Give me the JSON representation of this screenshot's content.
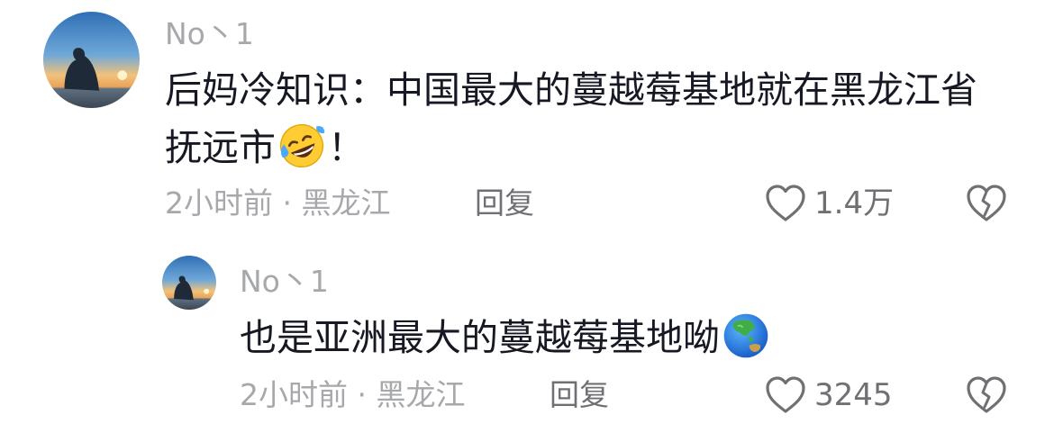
{
  "comments": [
    {
      "username": "No丶1",
      "text_before_emoji": "后妈冷知识：中国最大的蔓越莓基地就在黑龙江省抚远市",
      "emoji_icon": "rolling-on-floor-laughing-emoji",
      "text_after_emoji": "！",
      "meta": "2小时前 · 黑龙江",
      "reply_label": "回复",
      "likes": "1.4万",
      "replies": [
        {
          "username": "No丶1",
          "text_before_emoji": "也是亚洲最大的蔓越莓基地呦",
          "emoji_icon": "globe-asia-australia-emoji",
          "meta": "2小时前 · 黑龙江",
          "reply_label": "回复",
          "likes": "3245"
        }
      ]
    }
  ],
  "colors": {
    "text_primary": "#161823",
    "text_secondary": "#a7a8ac",
    "action_text": "#6f7074",
    "icon_stroke": "#6f7074"
  }
}
